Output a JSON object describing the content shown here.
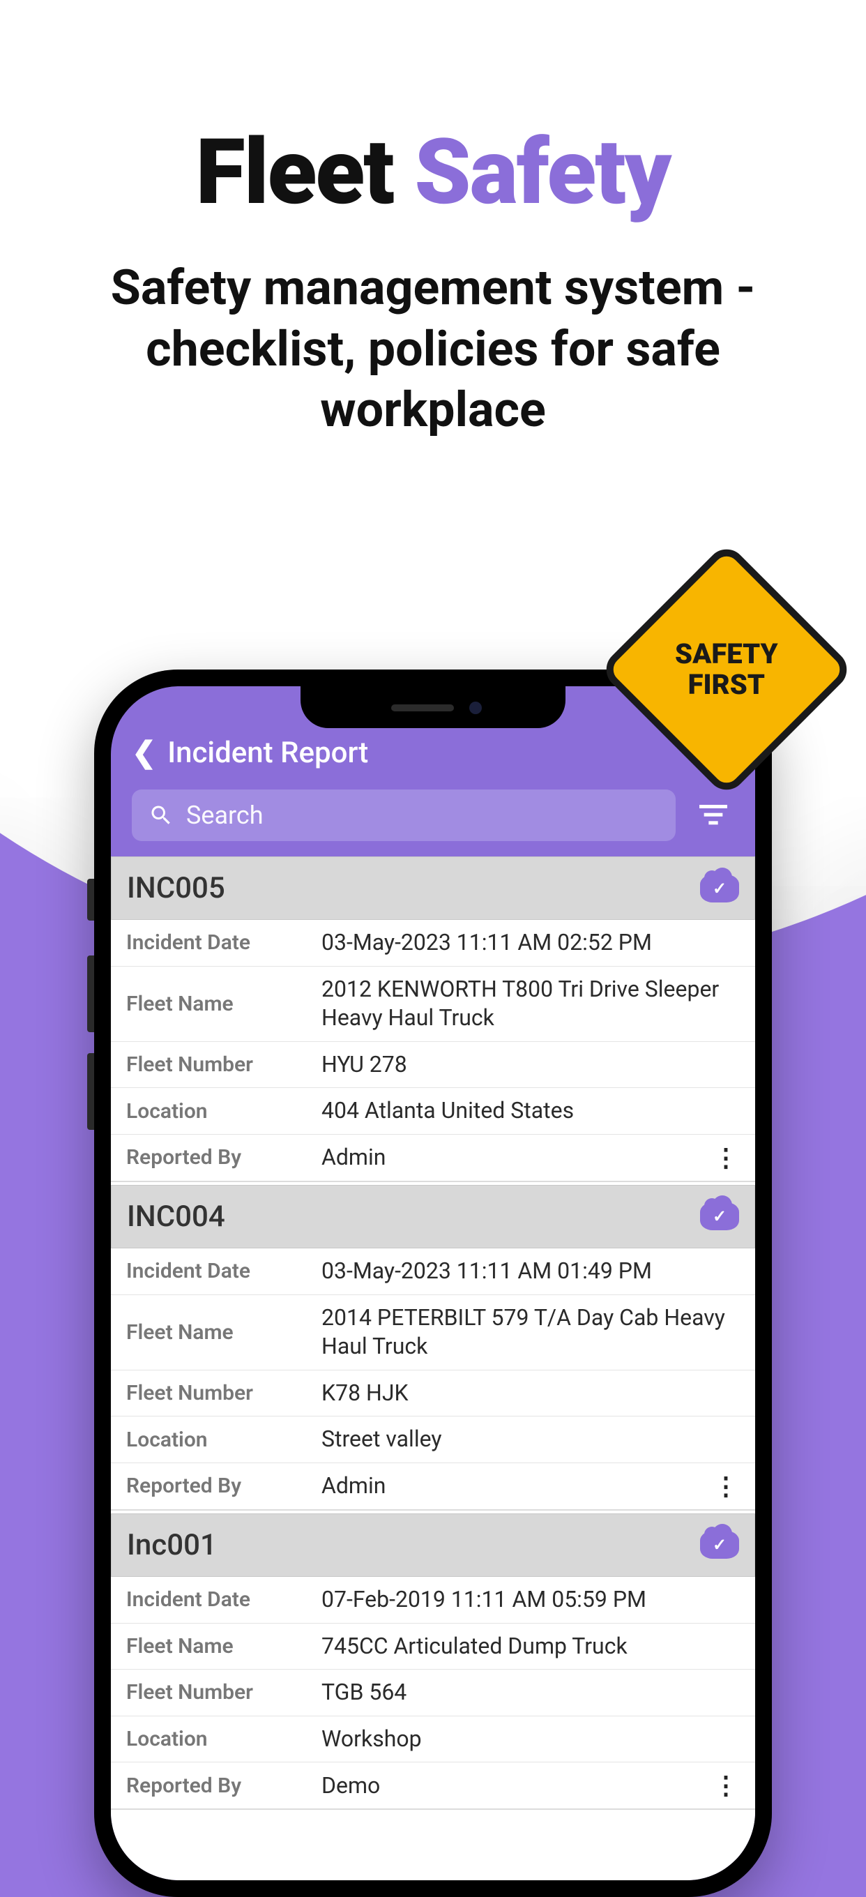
{
  "hero": {
    "title_black": "Fleet ",
    "title_purple": "Safety",
    "subtitle": "Safety management system - checklist, policies for safe workplace"
  },
  "safety_sign": {
    "line1": "SAFETY",
    "line2": "FIRST"
  },
  "app": {
    "header": {
      "title": "Incident Report"
    },
    "search": {
      "placeholder": "Search"
    },
    "field_labels": {
      "incident_date": "Incident Date",
      "fleet_name": "Fleet Name",
      "fleet_number": "Fleet Number",
      "location": "Location",
      "reported_by": "Reported By"
    },
    "incidents": [
      {
        "id": "INC005",
        "incident_date": "03-May-2023 11:11 AM 02:52 PM",
        "fleet_name": "2012 KENWORTH T800 Tri Drive Sleeper Heavy Haul Truck",
        "fleet_number": "HYU 278",
        "location": "404 Atlanta United States",
        "reported_by": "Admin"
      },
      {
        "id": "INC004",
        "incident_date": "03-May-2023 11:11 AM 01:49 PM",
        "fleet_name": "2014 PETERBILT 579 T/A Day Cab Heavy Haul Truck",
        "fleet_number": "K78 HJK",
        "location": "Street valley",
        "reported_by": "Admin"
      },
      {
        "id": "Inc001",
        "incident_date": "07-Feb-2019 11:11 AM 05:59 PM",
        "fleet_name": "745CC Articulated Dump Truck",
        "fleet_number": "TGB 564",
        "location": "Workshop",
        "reported_by": "Demo"
      }
    ]
  }
}
